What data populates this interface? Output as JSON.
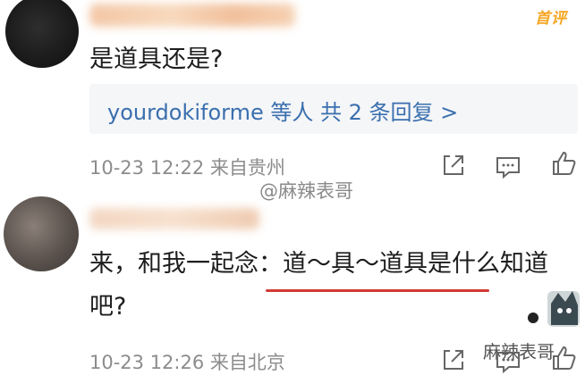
{
  "header": {
    "badge_label": "首评"
  },
  "comment1": {
    "text": "是道具还是?",
    "reply_summary": "yourdokiforme 等人  共 2 条回复 >",
    "meta": "10-23 12:22  来自贵州"
  },
  "watermark_center": "@麻辣表哥",
  "comment2": {
    "text": "来，和我一起念：道～具～道具是什么知道吧?",
    "meta": "10-23 12:26  来自北京"
  },
  "watermark_br": "麻辣表哥",
  "icons": {
    "share": "share-icon",
    "comment": "comment-icon",
    "like": "like-icon"
  },
  "colors": {
    "link": "#3a6fae",
    "underline": "#d23a36",
    "badge": "#f5a623",
    "meta": "#8c8c8c"
  }
}
